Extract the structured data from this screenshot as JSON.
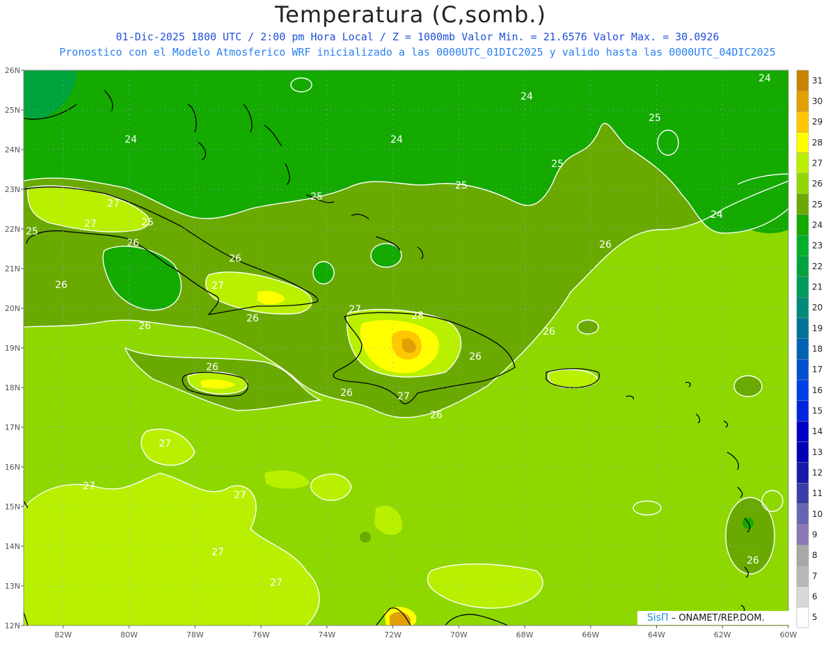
{
  "title": "Temperatura (C,somb.)",
  "subtitle1": "01-Dic-2025  1800 UTC / 2:00 pm Hora Local / Z = 1000mb   Valor Min. = 21.6576  Valor Max. = 30.0926",
  "subtitle2": "Pronostico con el Modelo Atmosferico WRF inicializado a las 0000UTC_01DIC2025 y valido hasta las  0000UTC_04DIC2025",
  "credit_logo": "SisΠ",
  "credit_text": "– ONAMET/REP.DOM.",
  "lat_labels": [
    "26N",
    "25N",
    "24N",
    "23N",
    "22N",
    "21N",
    "20N",
    "19N",
    "18N",
    "17N",
    "16N",
    "15N",
    "14N",
    "13N",
    "12N"
  ],
  "lon_labels": [
    "82W",
    "80W",
    "78W",
    "76W",
    "74W",
    "72W",
    "70W",
    "68W",
    "66W",
    "64W",
    "62W",
    "60W"
  ],
  "colorbar": {
    "levels": [
      "31",
      "30",
      "29",
      "28",
      "27",
      "26",
      "25",
      "24",
      "23",
      "22",
      "21",
      "20",
      "19",
      "18",
      "17",
      "16",
      "15",
      "14",
      "13",
      "12",
      "11",
      "10",
      "9",
      "8",
      "7",
      "6",
      "5"
    ],
    "colors": [
      "#c88400",
      "#e2a000",
      "#ffc800",
      "#ffff00",
      "#b8f000",
      "#8ed800",
      "#6aaa00",
      "#14aa00",
      "#00b028",
      "#00a43c",
      "#009a5a",
      "#008a78",
      "#007496",
      "#0062b4",
      "#0050d0",
      "#003ee8",
      "#0024e0",
      "#0000c8",
      "#0000b4",
      "#1a1aa8",
      "#3c3ca8",
      "#6666b4",
      "#8c78b4",
      "#a8a8a8",
      "#b8b8b8",
      "#d8d8d8",
      "#ffffff"
    ]
  },
  "contour_labels": [
    "24",
    "24",
    "24",
    "24",
    "24",
    "25",
    "25",
    "25",
    "25",
    "25",
    "25",
    "26",
    "26",
    "26",
    "26",
    "26",
    "26",
    "26",
    "26",
    "26",
    "26",
    "26",
    "26",
    "27",
    "27",
    "27",
    "27",
    "27",
    "27",
    "27",
    "27",
    "27",
    "27",
    "28"
  ],
  "field_range": {
    "min": 21.6576,
    "max": 30.0926
  },
  "colors": {
    "c24": "#14aa00",
    "c25": "#6aaa00",
    "c26": "#8ed800",
    "c27": "#b8f000",
    "c28": "#ffff00",
    "c29": "#ffc800",
    "c30": "#e2a000",
    "c23": "#00b028",
    "contour": "#ffffff",
    "coast": "#000000"
  }
}
